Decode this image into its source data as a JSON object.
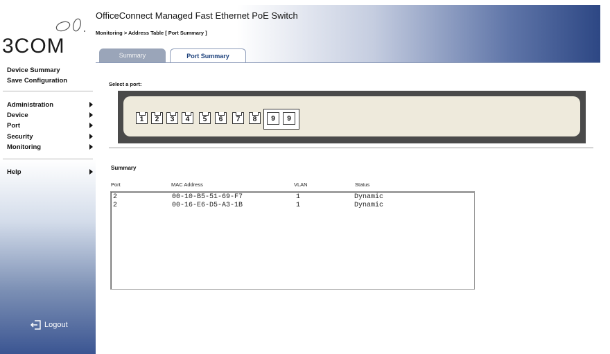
{
  "brand": {
    "logo_text": "3COM"
  },
  "sidebar": {
    "links": [
      "Device Summary",
      "Save Configuration"
    ],
    "menu": [
      "Administration",
      "Device",
      "Port",
      "Security",
      "Monitoring"
    ],
    "help": "Help",
    "logout": "Logout"
  },
  "header": {
    "title": "OfficeConnect Managed Fast Ethernet PoE Switch",
    "breadcrumb": "Monitoring > Address Table [ Port Summary ]",
    "tabs": [
      "Summary",
      "Port Summary"
    ],
    "active_tab": "Port Summary"
  },
  "port_selector": {
    "label": "Select a port:",
    "ports": [
      "1",
      "2",
      "3",
      "4",
      "5",
      "6",
      "7",
      "8"
    ],
    "sfp_ports": [
      "9",
      "9"
    ]
  },
  "summary": {
    "heading": "Summary",
    "columns": [
      "Port",
      "MAC Address",
      "VLAN",
      "Status"
    ],
    "rows": [
      {
        "port": "2",
        "mac": "00-10-B5-51-69-F7",
        "vlan": "1",
        "status": "Dynamic"
      },
      {
        "port": "2",
        "mac": "00-16-E6-D5-A3-1B",
        "vlan": "1",
        "status": "Dynamic"
      }
    ]
  },
  "colors": {
    "accent": "#2d4784",
    "tab_active_text": "#1a3f7a",
    "tab_inactive": "#9aa5b9"
  }
}
